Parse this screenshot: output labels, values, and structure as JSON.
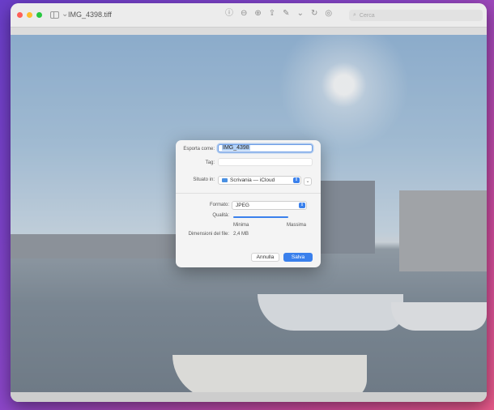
{
  "window": {
    "title": "IMG_4398.tiff",
    "search_placeholder": "Cerca"
  },
  "toolbar": {
    "icons": [
      "info-icon",
      "zoom-out-icon",
      "zoom-in-icon",
      "share-icon",
      "markup-icon",
      "chevron-down-icon",
      "rotate-icon",
      "annotate-icon"
    ]
  },
  "export_dialog": {
    "export_as_label": "Esporta come:",
    "export_as_value": "IMG_4398",
    "tag_label": "Tag:",
    "tag_value": "",
    "location_label": "Situato in:",
    "location_value": "Scrivania — iCloud",
    "format_label": "Formato:",
    "format_value": "JPEG",
    "quality_label": "Qualità:",
    "quality_min_label": "Minima",
    "quality_max_label": "Massima",
    "quality_level": 1.0,
    "file_size_label": "Dimensioni del file:",
    "file_size_value": "2,4 MB",
    "cancel_label": "Annulla",
    "save_label": "Salva"
  },
  "colors": {
    "accent": "#3a80ec",
    "close": "#ff5f57",
    "minimize": "#febc2e",
    "zoom": "#28c840"
  }
}
